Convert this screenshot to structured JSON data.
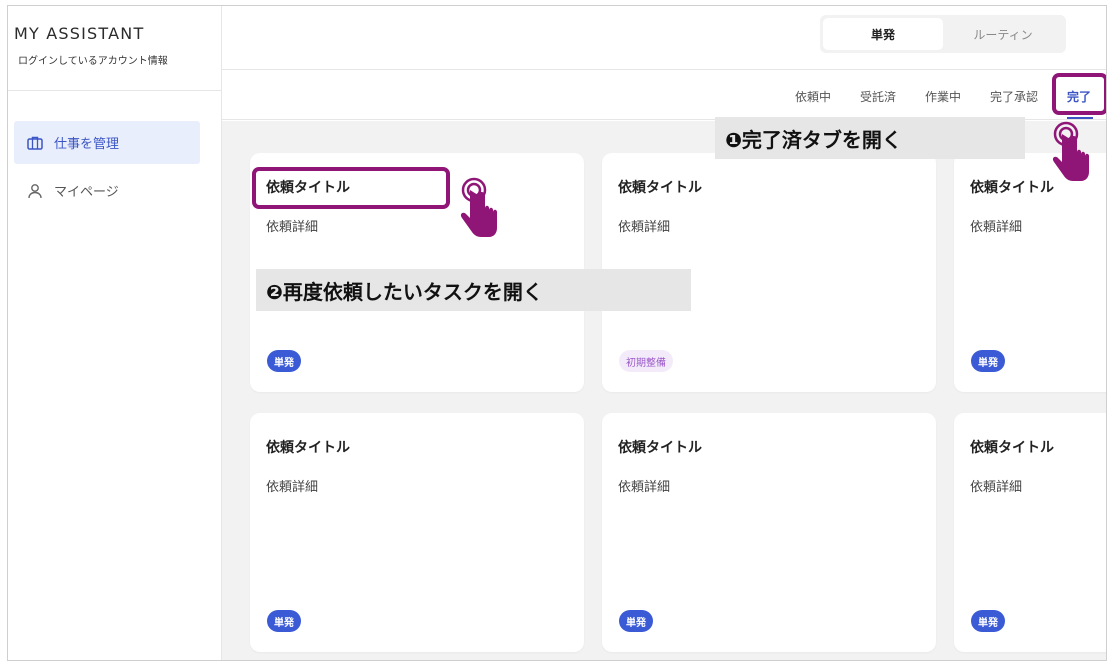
{
  "app": {
    "brand": "MY ASSISTANT",
    "account_label": "ログインしているアカウント情報"
  },
  "sidebar": {
    "items": [
      {
        "label": "仕事を管理",
        "icon": "briefcase-icon",
        "active": true
      },
      {
        "label": "マイページ",
        "icon": "user-icon",
        "active": false
      }
    ]
  },
  "header": {
    "mode_toggle": [
      {
        "label": "単発",
        "active": true
      },
      {
        "label": "ルーティン",
        "active": false
      }
    ]
  },
  "status_tabs": [
    {
      "label": "依頼中",
      "active": false
    },
    {
      "label": "受託済",
      "active": false
    },
    {
      "label": "作業中",
      "active": false
    },
    {
      "label": "完了承認",
      "active": false
    },
    {
      "label": "完了",
      "active": true
    }
  ],
  "cards": [
    {
      "title": "依頼タイトル",
      "detail": "依頼詳細",
      "badge": "単発",
      "badge_style": "blue"
    },
    {
      "title": "依頼タイトル",
      "detail": "依頼詳細",
      "badge": "初期整備",
      "badge_style": "purple"
    },
    {
      "title": "依頼タイトル",
      "detail": "依頼詳細",
      "badge": "単発",
      "badge_style": "blue"
    },
    {
      "title": "依頼タイトル",
      "detail": "依頼詳細",
      "badge": "単発",
      "badge_style": "blue"
    },
    {
      "title": "依頼タイトル",
      "detail": "依頼詳細",
      "badge": "単発",
      "badge_style": "blue"
    },
    {
      "title": "依頼タイトル",
      "detail": "依頼詳細",
      "badge": "単発",
      "badge_style": "blue"
    }
  ],
  "annotations": {
    "step1": "❶完了済タブを開く",
    "step2": "❷再度依頼したいタスクを開く",
    "highlight_color": "#8f1677"
  },
  "colors": {
    "accent": "#3b55c5",
    "badge_blue": "#3b5bd6",
    "badge_purple_text": "#9b59c9",
    "content_bg": "#f2f2f2"
  }
}
